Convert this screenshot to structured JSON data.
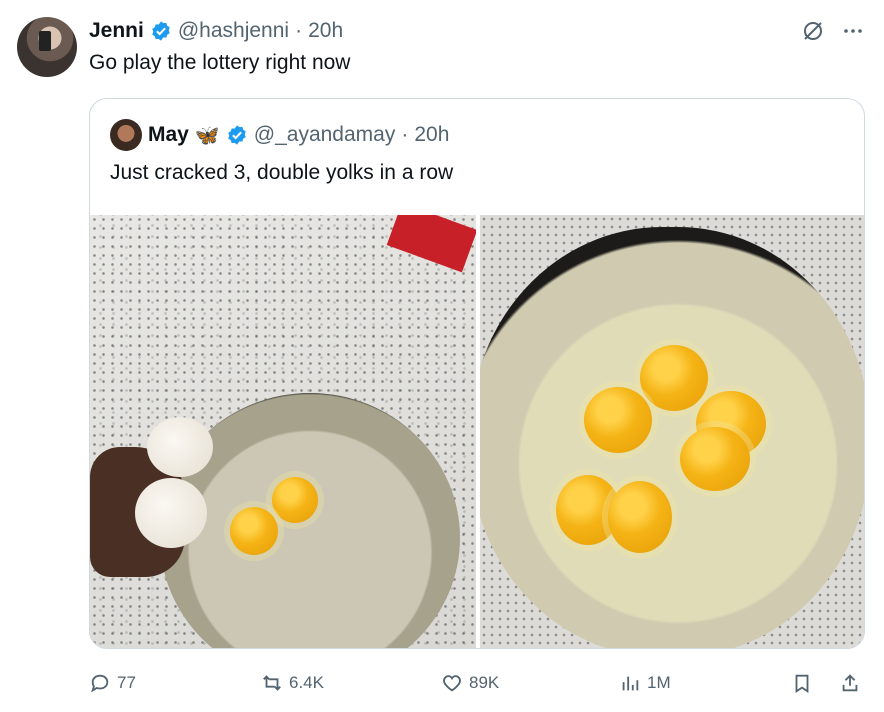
{
  "tweet": {
    "author_name": "Jenni",
    "handle": "@hashjenni",
    "separator": "·",
    "time": "20h",
    "text": "Go play the lottery right now"
  },
  "quote": {
    "author_name": "May",
    "handle": "@_ayandamay",
    "separator": "·",
    "time": "20h",
    "text": "Just cracked 3, double yolks in a row"
  },
  "actions": {
    "replies": "77",
    "retweets": "6.4K",
    "likes": "89K",
    "views": "1M"
  },
  "icons": {
    "verified": "verified-badge-icon",
    "grok": "grok-icon",
    "more": "more-icon",
    "reply": "reply-icon",
    "retweet": "retweet-icon",
    "like": "heart-icon",
    "views": "views-icon",
    "bookmark": "bookmark-icon",
    "share": "share-icon"
  },
  "colors": {
    "verified_blue": "#1d9bf0",
    "text_primary": "#0f1419",
    "text_muted": "#536471",
    "border": "#cfd9de"
  }
}
